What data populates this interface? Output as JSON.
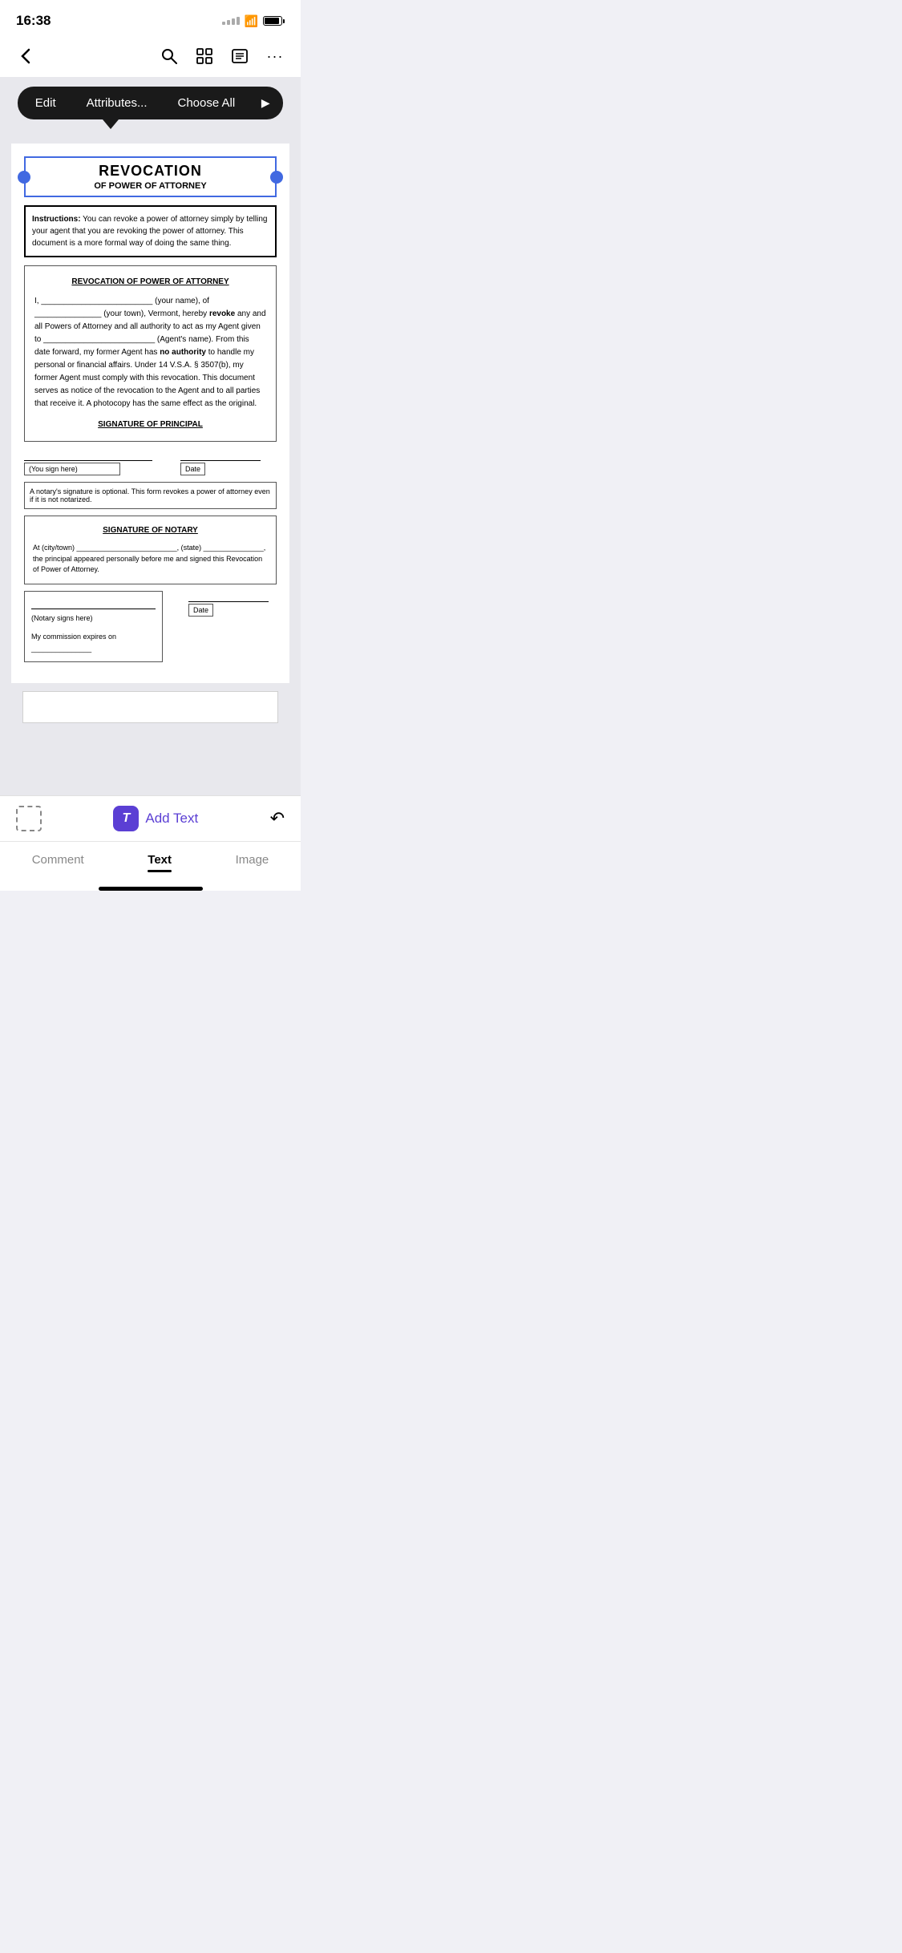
{
  "statusBar": {
    "time": "16:38"
  },
  "nav": {
    "backLabel": "‹",
    "searchLabel": "⌕",
    "gridLabel": "⊞",
    "listLabel": "☰",
    "moreLabel": "···"
  },
  "toolbar": {
    "editLabel": "Edit",
    "attributesLabel": "Attributes...",
    "chooseAllLabel": "Choose All",
    "playLabel": "▶"
  },
  "document": {
    "title": "REVOCATION",
    "subtitle": "OF POWER OF ATTORNEY",
    "instructionPrefix": "Instructions:",
    "instructionText": " You can revoke a power of attorney simply by telling your agent that you are revoking the power of attorney.  This document is a more formal way of doing the same thing.",
    "innerTitle": "REVOCATION OF POWER OF ATTORNEY",
    "bodyText": "I, _________________________ (your name), of _______________ (your town), Vermont, hereby revoke any and all Powers of Attorney and all authority to act as my Agent given to _________________________ (Agent's name).  From this date forward, my former Agent has no authority to handle my personal or financial affairs.  Under 14 V.S.A. § 3507(b), my former Agent must comply with this revocation. This document serves as notice of the revocation to the Agent and to all parties that receive it.  A photocopy has the same effect as the original.",
    "sigPrincipal": "SIGNATURE OF PRINCIPAL",
    "youSignHere": "(You sign here)",
    "dateLabel": "Date",
    "notaryNote": "A notary's signature is optional.  This form revokes a power of attorney even if it is not notarized.",
    "sigNotary": "SIGNATURE OF NOTARY",
    "notaryBody": "At (city/town) _________________________, (state) _______________, the principal appeared personally before me and signed this Revocation of Power of Attorney.",
    "notarySigns": "(Notary signs here)",
    "notaryDate": "Date",
    "commissionText": "My commission expires on _______________"
  },
  "bottomBar": {
    "addTextLabel": "Add Text",
    "iconText": "T",
    "tabs": [
      {
        "label": "Comment",
        "active": false
      },
      {
        "label": "Text",
        "active": true
      },
      {
        "label": "Image",
        "active": false
      }
    ]
  }
}
